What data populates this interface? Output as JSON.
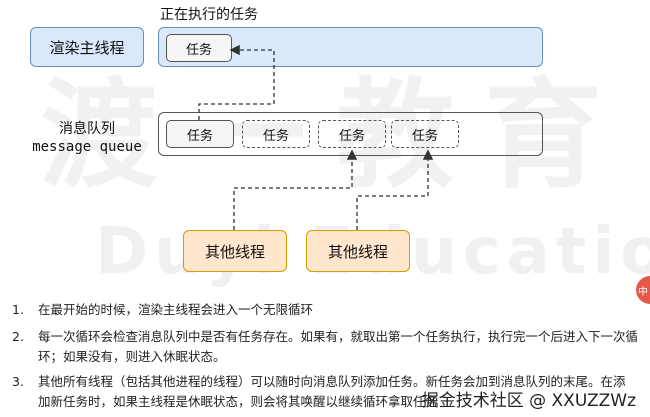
{
  "watermark": {
    "cn": "渡一教育",
    "en": "Duyi Education"
  },
  "diagram": {
    "running_title": "正在执行的任务",
    "render_thread": "渲染主线程",
    "running_task": "任务",
    "queue_label_cn": "消息队列",
    "queue_label_en": "message queue",
    "queue_tasks": [
      "任务",
      "任务",
      "任务",
      "任务"
    ],
    "other_threads": [
      "其他线程",
      "其他线程"
    ]
  },
  "notes": [
    {
      "num": "1.",
      "text": "在最开始的时候，渲染主线程会进入一个无限循环"
    },
    {
      "num": "2.",
      "text": "每一次循环会检查消息队列中是否有任务存在。如果有，就取出第一个任务执行，执行完一个后进入下一次循环；如果没有，则进入休眠状态。"
    },
    {
      "num": "3.",
      "text": "其他所有线程（包括其他进程的线程）可以随时向消息队列添加任务。新任务会加到消息队列的末尾。在添加新任务时，如果主线程是休眠状态，则会将其唤醒以继续循环拿取任务"
    }
  ],
  "footer": "掘金技术社区 @ XXUZZWz",
  "badge": "中"
}
